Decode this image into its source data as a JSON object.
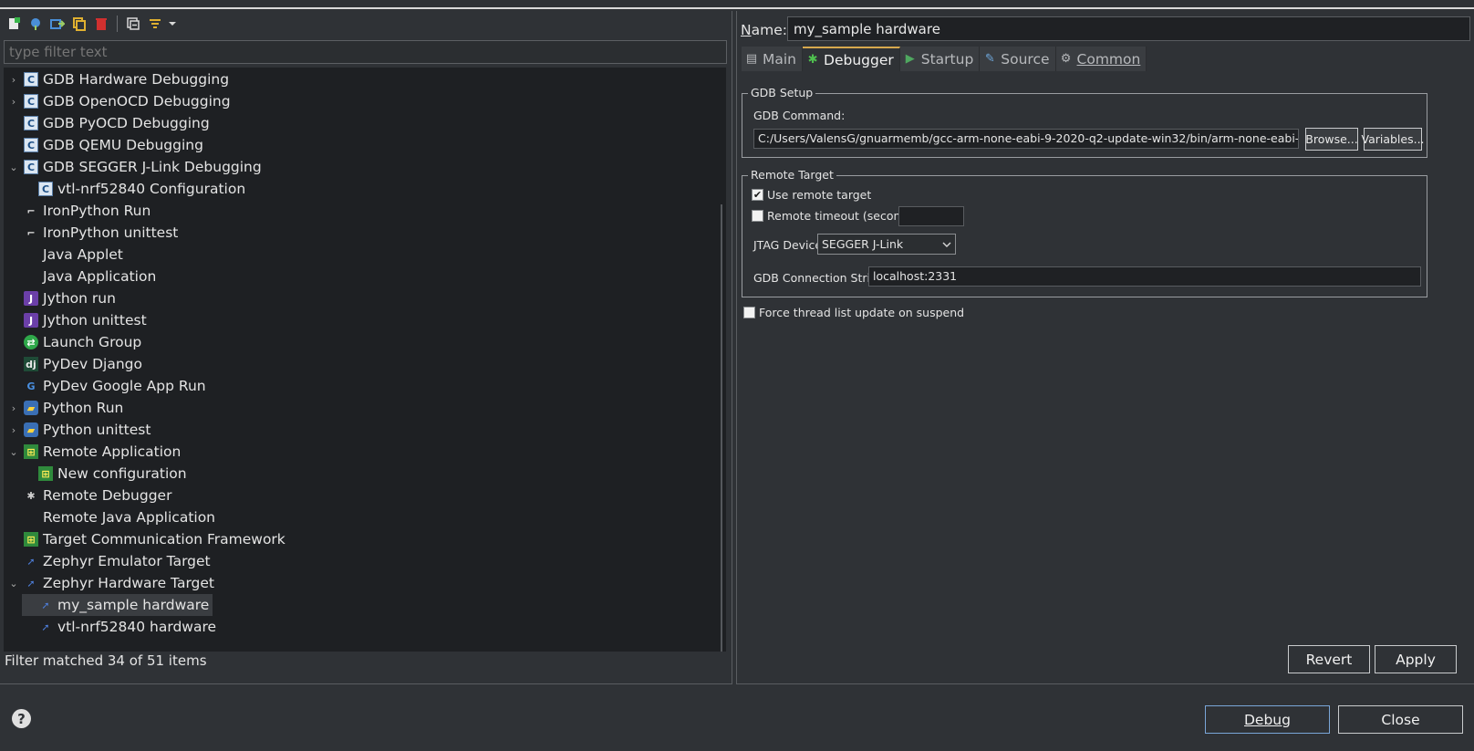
{
  "toolbar": {
    "icons": [
      "new-configuration-icon",
      "new-prototype-icon",
      "export-icon",
      "duplicate-icon",
      "delete-icon",
      "collapse-all-icon",
      "filter-icon",
      "chevron-down-icon"
    ]
  },
  "filter": {
    "placeholder": "type filter text"
  },
  "tree": {
    "items": [
      {
        "label": "GDB Hardware Debugging",
        "level": 0,
        "chevron": "›",
        "icon": "c"
      },
      {
        "label": "GDB OpenOCD Debugging",
        "level": 0,
        "chevron": "›",
        "icon": "c"
      },
      {
        "label": "GDB PyOCD Debugging",
        "level": 0,
        "chevron": "",
        "icon": "c"
      },
      {
        "label": "GDB QEMU Debugging",
        "level": 0,
        "chevron": "",
        "icon": "c"
      },
      {
        "label": "GDB SEGGER J-Link Debugging",
        "level": 0,
        "chevron": "⌄",
        "icon": "c"
      },
      {
        "label": "vtl-nrf52840 Configuration",
        "level": 1,
        "chevron": "",
        "icon": "c"
      },
      {
        "label": "IronPython Run",
        "level": 0,
        "chevron": "",
        "icon": "iron"
      },
      {
        "label": "IronPython unittest",
        "level": 0,
        "chevron": "",
        "icon": "iron"
      },
      {
        "label": "Java Applet",
        "level": 0,
        "chevron": "",
        "icon": "none"
      },
      {
        "label": "Java Application",
        "level": 0,
        "chevron": "",
        "icon": "none"
      },
      {
        "label": "Jython run",
        "level": 0,
        "chevron": "",
        "icon": "jy"
      },
      {
        "label": "Jython unittest",
        "level": 0,
        "chevron": "",
        "icon": "jy"
      },
      {
        "label": "Launch Group",
        "level": 0,
        "chevron": "",
        "icon": "launch"
      },
      {
        "label": "PyDev Django",
        "level": 0,
        "chevron": "",
        "icon": "dj"
      },
      {
        "label": "PyDev Google App Run",
        "level": 0,
        "chevron": "",
        "icon": "g"
      },
      {
        "label": "Python Run",
        "level": 0,
        "chevron": "›",
        "icon": "py"
      },
      {
        "label": "Python unittest",
        "level": 0,
        "chevron": "›",
        "icon": "py"
      },
      {
        "label": "Remote Application",
        "level": 0,
        "chevron": "⌄",
        "icon": "tcf"
      },
      {
        "label": "New configuration",
        "level": 1,
        "chevron": "",
        "icon": "tcf"
      },
      {
        "label": "Remote Debugger",
        "level": 0,
        "chevron": "",
        "icon": "gear"
      },
      {
        "label": "Remote Java Application",
        "level": 0,
        "chevron": "",
        "icon": "none"
      },
      {
        "label": "Target Communication Framework",
        "level": 0,
        "chevron": "",
        "icon": "tcf"
      },
      {
        "label": "Zephyr Emulator Target",
        "level": 0,
        "chevron": "",
        "icon": "zeph"
      },
      {
        "label": "Zephyr Hardware Target",
        "level": 0,
        "chevron": "⌄",
        "icon": "zeph"
      },
      {
        "label": "my_sample hardware",
        "level": 1,
        "chevron": "",
        "icon": "zeph",
        "selected": true
      },
      {
        "label": "vtl-nrf52840 hardware",
        "level": 1,
        "chevron": "",
        "icon": "zeph"
      }
    ]
  },
  "status": "Filter matched 34 of 51 items",
  "config": {
    "name_label_first": "N",
    "name_label_rest": "ame:",
    "name_value": "my_sample hardware",
    "tabs": [
      {
        "label": "Main",
        "icon": "main-tab-icon",
        "glyph": "▤",
        "active": false
      },
      {
        "label": "Debugger",
        "icon": "debugger-tab-icon",
        "glyph": "✱",
        "active": true
      },
      {
        "label": "Startup",
        "icon": "startup-tab-icon",
        "glyph": "▶",
        "active": false
      },
      {
        "label": "Source",
        "icon": "source-tab-icon",
        "glyph": "✎",
        "active": false
      },
      {
        "label": "Common",
        "icon": "common-tab-icon",
        "glyph": "⚙",
        "active": false
      }
    ],
    "gdb_setup": {
      "legend": "GDB Setup",
      "command_label": "GDB Command:",
      "command_value": "C:/Users/ValensG/gnuarmemb/gcc-arm-none-eabi-9-2020-q2-update-win32/bin/arm-none-eabi-gdb.exe",
      "browse_label": "Browse...",
      "variables_label": "Variables..."
    },
    "remote_target": {
      "legend": "Remote Target",
      "use_remote_label": "Use remote target",
      "use_remote_checked": true,
      "timeout_label": "Remote timeout (seconds):",
      "timeout_checked": false,
      "timeout_value": "",
      "jtag_label": "JTAG Device:",
      "jtag_value": "SEGGER J-Link",
      "conn_label": "GDB Connection String:",
      "conn_value": "localhost:2331"
    },
    "force_thread_label": "Force thread list update on suspend",
    "revert_label": "Revert",
    "apply_label": "Apply"
  },
  "footer": {
    "debug_label": "Debug",
    "close_label": "Close"
  },
  "colors": {
    "accent_tab": "#d7a84e",
    "tree_bg": "#1e2023",
    "pane_bg": "#2f3236"
  }
}
